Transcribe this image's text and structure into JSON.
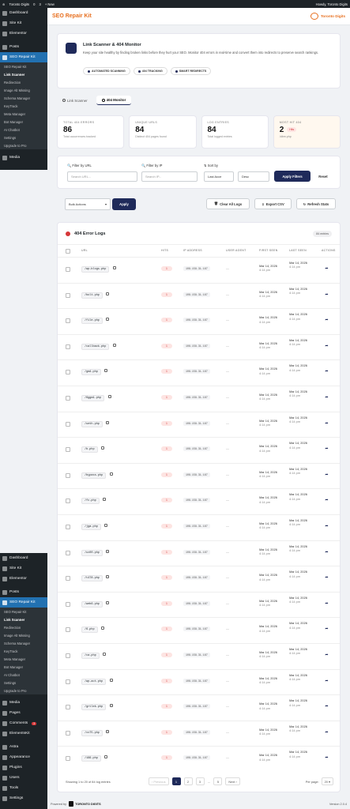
{
  "admin_bar": {
    "site": "Toronto Digits",
    "updates": "0",
    "comments": "3",
    "new_label": "+ New",
    "howdy": "Howdy, Toronto Digits"
  },
  "sidebar_top": {
    "items": [
      "Dashboard",
      "Site Kit",
      "Elementor",
      "Posts",
      "SEO Repair Kit"
    ],
    "sub": [
      "SEO Repair Kit",
      "Link Scanner",
      "Redirection",
      "Image Alt Missing",
      "Schema Manager",
      "KeyTrack",
      "Meta Manager",
      "Bot Manager",
      "AI Chatbot",
      "Settings",
      "Upgrade to Pro"
    ],
    "after": [
      "Media"
    ]
  },
  "sidebar_bottom": {
    "items": [
      "Dashboard",
      "Site Kit",
      "Elementor",
      "Posts",
      "SEO Repair Kit"
    ],
    "sub": [
      "SEO Repair Kit",
      "Link Scanner",
      "Redirection",
      "Image Alt Missing",
      "Schema Manager",
      "KeyTrack",
      "Meta Manager",
      "Bot Manager",
      "AI Chatbot",
      "Settings",
      "Upgrade to Pro"
    ],
    "after": [
      "Media",
      "Pages",
      "Comments",
      "ElementsKit",
      "Astra",
      "Appearance",
      "Plugins",
      "Users",
      "Tools",
      "Settings",
      "Collapse Menu"
    ],
    "comments_badge": "3"
  },
  "header": {
    "title": "SEO Repair Kit",
    "brand": "Toronto Digits"
  },
  "hero": {
    "title": "Link Scanner & 404 Monitor",
    "desc": "Keep your site healthy by finding broken links before they hurt your SEO. Monitor 404 errors in real-time and convert them into redirects to preserve search rankings.",
    "features": [
      "AUTOMATED SCANNING",
      "404 TRACKING",
      "SMART REDIRECTS"
    ]
  },
  "tabs": [
    "Link Scanner",
    "404 Monitor"
  ],
  "stats": [
    {
      "label": "TOTAL 404 ERRORS",
      "value": "86",
      "sub": "Total occurrences tracked"
    },
    {
      "label": "UNIQUE URLS",
      "value": "84",
      "sub": "Distinct 404 pages found"
    },
    {
      "label": "LOG ENTRIES",
      "value": "84",
      "sub": "Total logged entries"
    },
    {
      "label": "MOST HIT 404",
      "value": "2",
      "badge": "Hits",
      "sub": "/dbm.php"
    }
  ],
  "filters": {
    "url_label": "Filter by URL",
    "url_placeholder": "Search URL...",
    "ip_label": "Filter by IP",
    "ip_placeholder": "Search IP...",
    "sort_label": "Sort by",
    "sort_value": "Last Acce",
    "order_value": "Desc",
    "apply": "Apply Filters",
    "reset": "Reset"
  },
  "bulk": {
    "select": "Bulk Actions",
    "apply": "Apply",
    "clear": "Clear All Logs",
    "export": "Export CSV",
    "refresh": "Refresh Stats"
  },
  "table": {
    "title": "404 Error Logs",
    "count": "84 entries",
    "columns": [
      "URL",
      "HITS",
      "IP ADDRESS",
      "USER AGENT",
      "FIRST SEEN",
      "LAST SEEN",
      "ACTIONS"
    ],
    "rows": [
      {
        "url": "/wp-blogs.php",
        "hits": "1",
        "ip": "108.158.31.167",
        "ua": "—",
        "first_date": "Mar 14, 2026",
        "first_time": "4:14 pm",
        "last_date": "Mar 14, 2026",
        "last_time": "4:14 pm"
      },
      {
        "url": "/bolt.php",
        "hits": "1",
        "ip": "108.158.31.167",
        "ua": "—",
        "first_date": "Mar 14, 2026",
        "first_time": "4:14 pm",
        "last_date": "Mar 14, 2026",
        "last_time": "4:14 pm"
      },
      {
        "url": "/file.php",
        "hits": "1",
        "ip": "108.158.31.167",
        "ua": "—",
        "first_date": "Mar 14, 2026",
        "first_time": "4:14 pm",
        "last_date": "Mar 14, 2026",
        "last_time": "4:14 pm"
      },
      {
        "url": "/callback.php",
        "hits": "1",
        "ip": "108.158.31.167",
        "ua": "—",
        "first_date": "Mar 14, 2026",
        "first_time": "4:14 pm",
        "last_date": "Mar 14, 2026",
        "last_time": "4:14 pm"
      },
      {
        "url": "/gm4.php",
        "hits": "1",
        "ip": "108.158.31.167",
        "ua": "—",
        "first_date": "Mar 14, 2026",
        "first_time": "4:14 pm",
        "last_date": "Mar 14, 2026",
        "last_time": "4:14 pm"
      },
      {
        "url": "/6ggm1.php",
        "hits": "1",
        "ip": "108.158.31.167",
        "ua": "—",
        "first_date": "Mar 14, 2026",
        "first_time": "4:14 pm",
        "last_date": "Mar 14, 2026",
        "last_time": "4:14 pm"
      },
      {
        "url": "/ueth.php",
        "hits": "1",
        "ip": "108.158.31.167",
        "ua": "—",
        "first_date": "Mar 14, 2026",
        "first_time": "4:14 pm",
        "last_date": "Mar 14, 2026",
        "last_time": "4:14 pm"
      },
      {
        "url": "/b.php",
        "hits": "1",
        "ip": "108.158.31.167",
        "ua": "—",
        "first_date": "Mar 14, 2026",
        "first_time": "4:14 pm",
        "last_date": "Mar 14, 2026",
        "last_time": "4:14 pm"
      },
      {
        "url": "/bypass.php",
        "hits": "1",
        "ip": "108.158.31.167",
        "ua": "—",
        "first_date": "Mar 14, 2026",
        "first_time": "4:14 pm",
        "last_date": "Mar 14, 2026",
        "last_time": "4:14 pm"
      },
      {
        "url": "/fc.php",
        "hits": "1",
        "ip": "108.158.31.167",
        "ua": "—",
        "first_date": "Mar 14, 2026",
        "first_time": "4:14 pm",
        "last_date": "Mar 14, 2026",
        "last_time": "4:14 pm"
      },
      {
        "url": "/jga.php",
        "hits": "1",
        "ip": "108.158.31.167",
        "ua": "—",
        "first_date": "Mar 14, 2026",
        "first_time": "4:14 pm",
        "last_date": "Mar 14, 2026",
        "last_time": "4:14 pm"
      },
      {
        "url": "/ux00.php",
        "hits": "1",
        "ip": "108.158.31.167",
        "ua": "—",
        "first_date": "Mar 14, 2026",
        "first_time": "4:14 pm",
        "last_date": "Mar 14, 2026",
        "last_time": "4:14 pm"
      },
      {
        "url": "/t478.php",
        "hits": "1",
        "ip": "108.158.31.167",
        "ua": "—",
        "first_date": "Mar 14, 2026",
        "first_time": "4:14 pm",
        "last_date": "Mar 14, 2026",
        "last_time": "4:14 pm"
      },
      {
        "url": "/web6.php",
        "hits": "1",
        "ip": "108.158.31.167",
        "ua": "—",
        "first_date": "Mar 14, 2026",
        "first_time": "4:14 pm",
        "last_date": "Mar 14, 2026",
        "last_time": "4:14 pm"
      },
      {
        "url": "/6.php",
        "hits": "1",
        "ip": "108.158.31.167",
        "ua": "—",
        "first_date": "Mar 14, 2026",
        "first_time": "4:14 pm",
        "last_date": "Mar 14, 2026",
        "last_time": "4:14 pm"
      },
      {
        "url": "/ca.php",
        "hits": "1",
        "ip": "108.158.31.167",
        "ua": "—",
        "first_date": "Mar 14, 2026",
        "first_time": "4:14 pm",
        "last_date": "Mar 14, 2026",
        "last_time": "4:14 pm"
      },
      {
        "url": "/wp-act.php",
        "hits": "1",
        "ip": "108.158.31.167",
        "ua": "—",
        "first_date": "Mar 14, 2026",
        "first_time": "4:14 pm",
        "last_date": "Mar 14, 2026",
        "last_time": "4:14 pm"
      },
      {
        "url": "/grtlek.php",
        "hits": "1",
        "ip": "108.158.31.167",
        "ua": "—",
        "first_date": "Mar 14, 2026",
        "first_time": "4:14 pm",
        "last_date": "Mar 14, 2026",
        "last_time": "4:14 pm"
      },
      {
        "url": "/xx75.php",
        "hits": "1",
        "ip": "108.158.31.167",
        "ua": "—",
        "first_date": "Mar 14, 2026",
        "first_time": "4:14 pm",
        "last_date": "Mar 14, 2026",
        "last_time": "4:14 pm"
      },
      {
        "url": "/166.php",
        "hits": "1",
        "ip": "108.158.31.167",
        "ua": "—",
        "first_date": "Mar 14, 2026",
        "first_time": "4:14 pm",
        "last_date": "Mar 14, 2026",
        "last_time": "4:14 pm"
      }
    ]
  },
  "pagination": {
    "showing": "Showing 1 to 20 of 84 log entries",
    "prev": "‹ Previous",
    "pages": [
      "1",
      "2",
      "3",
      "…",
      "5"
    ],
    "next": "Next ›",
    "per_page_label": "Per page:",
    "per_page": "20"
  },
  "footer": {
    "powered": "Powered by",
    "brand": "TORONTO DIGITS",
    "version": "Version 2.0.4"
  }
}
